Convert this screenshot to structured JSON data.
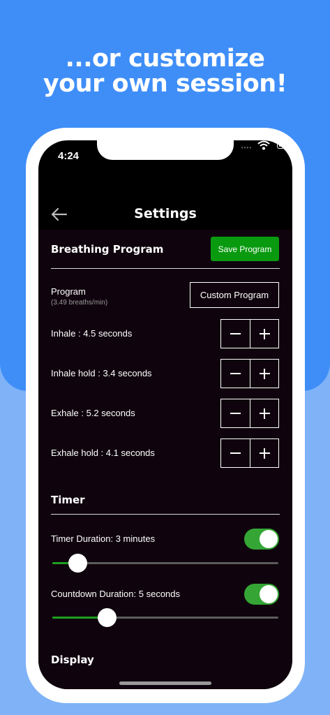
{
  "headline": {
    "line1": "...or customize",
    "line2": "your own session!"
  },
  "status_bar": {
    "time": "4:24",
    "signal": "••••"
  },
  "nav": {
    "title": "Settings",
    "back_icon": "arrow-left-icon"
  },
  "breathing": {
    "title": "Breathing Program",
    "save_label": "Save Program",
    "program_label": "Program",
    "program_rate": "(3.49 breaths/min)",
    "program_value": "Custom Program",
    "steps": [
      {
        "label": "Inhale : 4.5 seconds"
      },
      {
        "label": "Inhale hold : 3.4 seconds"
      },
      {
        "label": "Exhale : 5.2 seconds"
      },
      {
        "label": "Exhale hold : 4.1 seconds"
      }
    ]
  },
  "timer": {
    "title": "Timer",
    "duration_label": "Timer Duration: 3 minutes",
    "duration_enabled": true,
    "duration_slider": 0.11,
    "countdown_label": "Countdown Duration: 5 seconds",
    "countdown_enabled": true,
    "countdown_slider": 0.24
  },
  "display": {
    "title": "Display"
  },
  "colors": {
    "accent_green": "#0a9a10",
    "toggle_green": "#35a635",
    "background_blue": "#3f8ef8"
  }
}
